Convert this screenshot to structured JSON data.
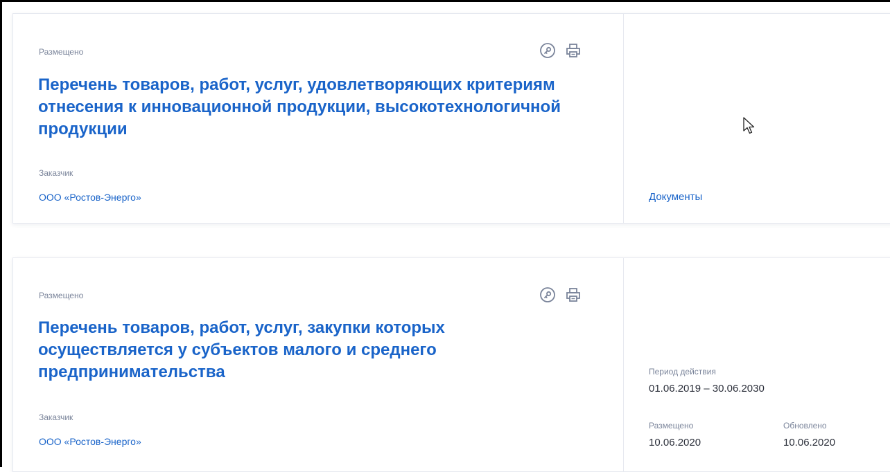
{
  "cards": [
    {
      "status": "Размещено",
      "title": "Перечень товаров, работ, услуг, удовлетворяющих критериям отнесения к инновационной продукции, высокотехнологичной продукции",
      "customer_label": "Заказчик",
      "customer": "ООО «Ростов-Энерго»",
      "side": {
        "documents_link": "Документы"
      }
    },
    {
      "status": "Размещено",
      "title": "Перечень товаров, работ, услуг, закупки которых осуществляется у субъектов малого и среднего предпринимательства",
      "customer_label": "Заказчик",
      "customer": "ООО «Ростов-Энерго»",
      "side": {
        "period_label": "Период действия",
        "period_value": "01.06.2019 – 30.06.2030",
        "posted_label": "Размещено",
        "posted_value": "10.06.2020",
        "updated_label": "Обновлено",
        "updated_value": "10.06.2020"
      }
    }
  ],
  "icons": {
    "key": "key-icon",
    "print": "printer-icon"
  },
  "colors": {
    "link": "#1a64c9",
    "muted": "#7a849a",
    "border": "#e6e9f0",
    "text": "#2b2f3a"
  }
}
